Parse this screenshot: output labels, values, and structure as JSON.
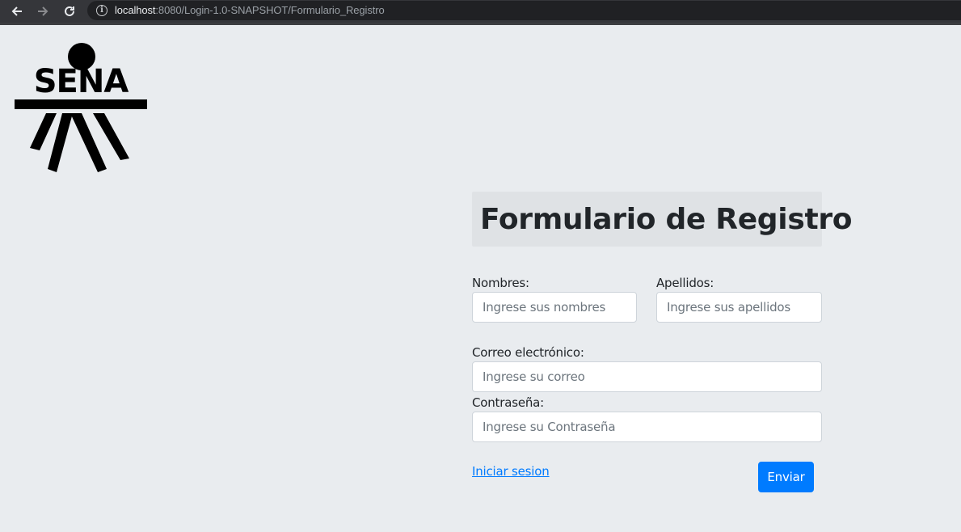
{
  "browser": {
    "back_icon": "arrow-left-icon",
    "forward_icon": "arrow-right-icon",
    "reload_icon": "reload-icon",
    "info_icon": "info-icon",
    "url_host": "localhost",
    "url_rest": ":8080/Login-1.0-SNAPSHOT/Formulario_Registro"
  },
  "logo": {
    "text": "SENA"
  },
  "form": {
    "title": "Formulario de Registro",
    "nombres": {
      "label": "Nombres:",
      "placeholder": "Ingrese sus nombres",
      "value": ""
    },
    "apellidos": {
      "label": "Apellidos:",
      "placeholder": "Ingrese sus apellidos",
      "value": ""
    },
    "correo": {
      "label": "Correo electrónico:",
      "placeholder": "Ingrese su correo",
      "value": ""
    },
    "contrasena": {
      "label": "Contraseña:",
      "placeholder": "Ingrese su Contraseña",
      "value": ""
    },
    "login_link": "Iniciar sesion",
    "submit_label": "Enviar"
  },
  "colors": {
    "page_background": "#e9ecef",
    "primary": "#007bff",
    "browser_toolbar": "#35363a"
  }
}
